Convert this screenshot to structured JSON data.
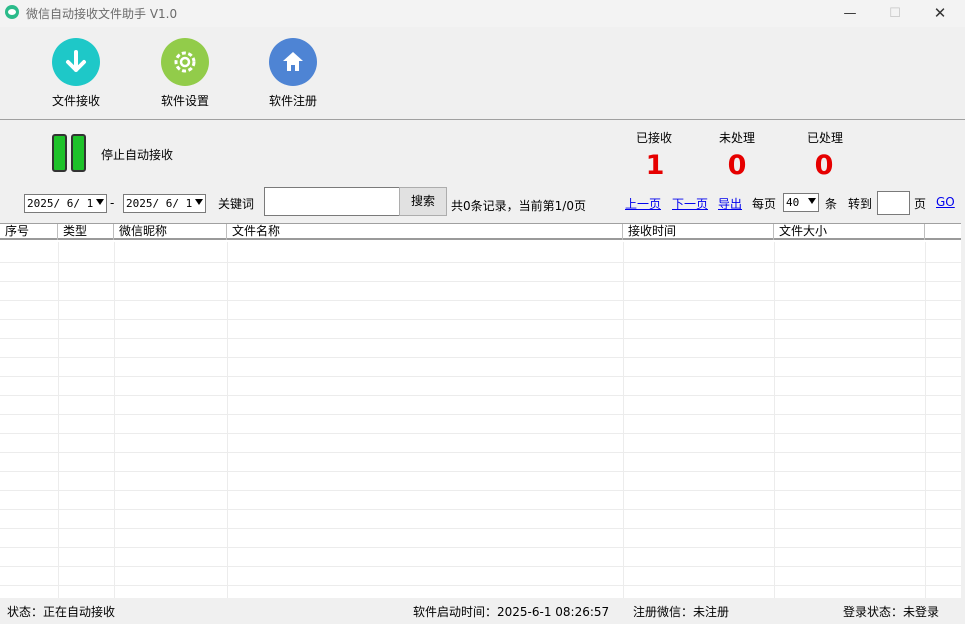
{
  "window": {
    "title": "微信自动接收文件助手 V1.0",
    "min_glyph": "—",
    "max_glyph": "☐",
    "close_glyph": "✕"
  },
  "toolbar": {
    "receive_label": "文件接收",
    "settings_label": "软件设置",
    "register_label": "软件注册"
  },
  "control": {
    "stop_label": "停止自动接收"
  },
  "stats": {
    "received_label": "已接收",
    "received_value": "1",
    "unprocessed_label": "未处理",
    "unprocessed_value": "0",
    "processed_label": "已处理",
    "processed_value": "0"
  },
  "filter": {
    "date_from": "2025/ 6/ 1",
    "dash": "-",
    "date_to": "2025/ 6/ 1",
    "keyword_label": "关键词",
    "keyword_value": "",
    "search_label": "搜索",
    "record_info": "共0条记录，当前第1/0页"
  },
  "pager": {
    "prev": "上一页",
    "next": "下一页",
    "export": "导出",
    "per_page_label": "每页",
    "per_page_value": "40",
    "unit": "条",
    "goto_label": "转到",
    "goto_value": "",
    "page_unit": "页",
    "go": "GO"
  },
  "table": {
    "columns": [
      "序号",
      "类型",
      "微信昵称",
      "文件名称",
      "接收时间",
      "文件大小"
    ],
    "rows": []
  },
  "status_bar": {
    "status": "状态：正在自动接收",
    "start_time": "软件启动时间：2025-6-1 08:26:57",
    "reg_wechat": "注册微信：未注册",
    "login_status": "登录状态：未登录"
  },
  "colors": {
    "stat_value": "#e60000",
    "receive_icon": "#1ec8c8",
    "settings_icon": "#92cc4a",
    "register_icon": "#4e84d4",
    "pause_icon": "#1ec22a",
    "link": "#0000ee"
  },
  "icons": {
    "receive": "download-arrow-icon",
    "settings": "gear-icon",
    "register": "home-icon",
    "control": "pause-icon"
  }
}
